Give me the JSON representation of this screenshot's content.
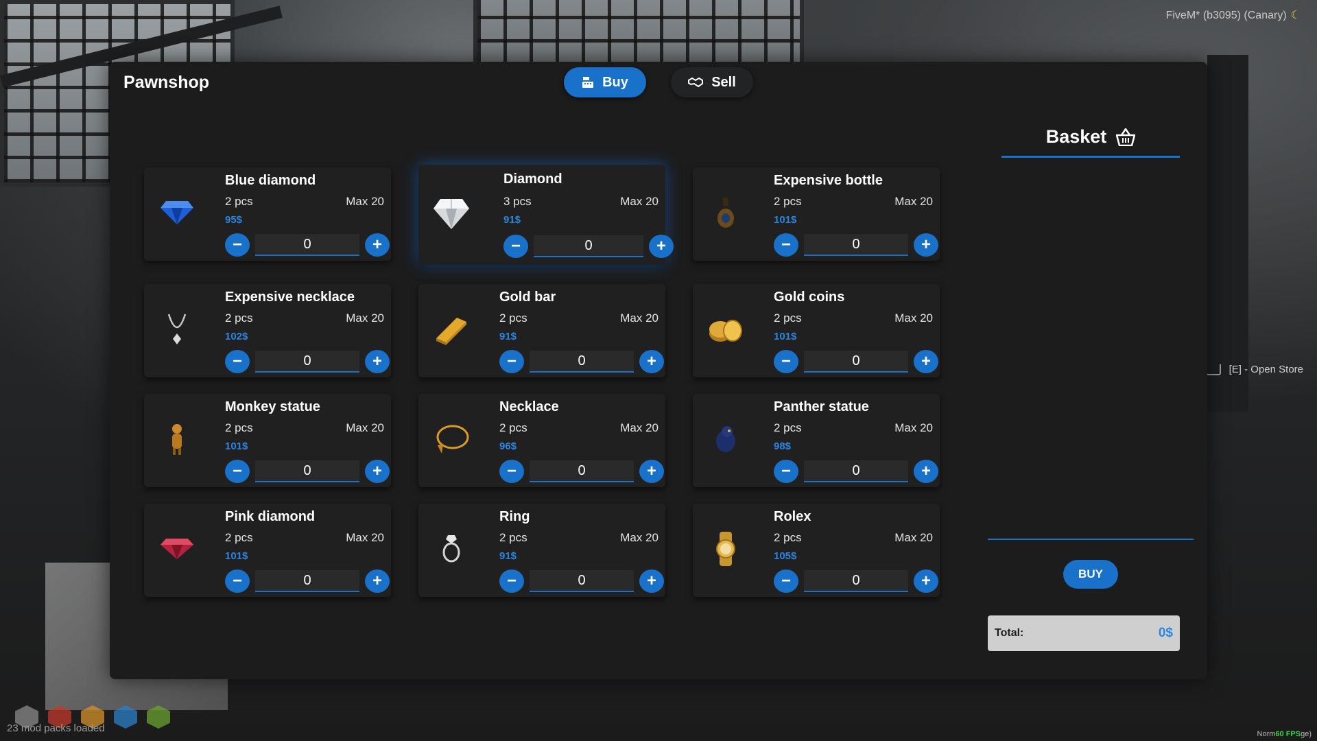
{
  "hud": {
    "build": "FiveM* (b3095) (Canary)",
    "open_store": "[E] - Open Store",
    "mod_packs": "23 mod packs loaded",
    "fps_prefix": "Norm",
    "fps": "60 FPS",
    "fps_suffix": "ge)"
  },
  "shop": {
    "title": "Pawnshop",
    "tabs": [
      {
        "label": "Buy",
        "icon": "cash-register-icon",
        "active": true
      },
      {
        "label": "Sell",
        "icon": "handshake-icon",
        "active": false
      }
    ]
  },
  "items": [
    {
      "name": "Blue diamond",
      "pcs": "2 pcs",
      "max": "Max 20",
      "price": "95$",
      "qty": "0",
      "icon": "blue-diamond-icon"
    },
    {
      "name": "Diamond",
      "pcs": "3 pcs",
      "max": "Max 20",
      "price": "91$",
      "qty": "0",
      "icon": "diamond-icon",
      "selected": true
    },
    {
      "name": "Expensive bottle",
      "pcs": "2 pcs",
      "max": "Max 20",
      "price": "101$",
      "qty": "0",
      "icon": "bottle-icon"
    },
    {
      "name": "Expensive necklace",
      "pcs": "2 pcs",
      "max": "Max 20",
      "price": "102$",
      "qty": "0",
      "icon": "necklace-icon"
    },
    {
      "name": "Gold bar",
      "pcs": "2 pcs",
      "max": "Max 20",
      "price": "91$",
      "qty": "0",
      "icon": "gold-bar-icon"
    },
    {
      "name": "Gold coins",
      "pcs": "2 pcs",
      "max": "Max 20",
      "price": "101$",
      "qty": "0",
      "icon": "gold-coins-icon"
    },
    {
      "name": "Monkey statue",
      "pcs": "2 pcs",
      "max": "Max 20",
      "price": "101$",
      "qty": "0",
      "icon": "monkey-statue-icon"
    },
    {
      "name": "Necklace",
      "pcs": "2 pcs",
      "max": "Max 20",
      "price": "96$",
      "qty": "0",
      "icon": "gold-necklace-icon"
    },
    {
      "name": "Panther statue",
      "pcs": "2 pcs",
      "max": "Max 20",
      "price": "98$",
      "qty": "0",
      "icon": "panther-statue-icon"
    },
    {
      "name": "Pink diamond",
      "pcs": "2 pcs",
      "max": "Max 20",
      "price": "101$",
      "qty": "0",
      "icon": "pink-diamond-icon"
    },
    {
      "name": "Ring",
      "pcs": "2 pcs",
      "max": "Max 20",
      "price": "91$",
      "qty": "0",
      "icon": "ring-icon"
    },
    {
      "name": "Rolex",
      "pcs": "2 pcs",
      "max": "Max 20",
      "price": "105$",
      "qty": "0",
      "icon": "watch-icon"
    }
  ],
  "basket": {
    "title": "Basket",
    "buy_label": "BUY",
    "total_label": "Total:",
    "total_value": "0$"
  },
  "colors": {
    "accent": "#1a71c9",
    "price": "#2b86e0",
    "panel": "#1c1c1d"
  }
}
